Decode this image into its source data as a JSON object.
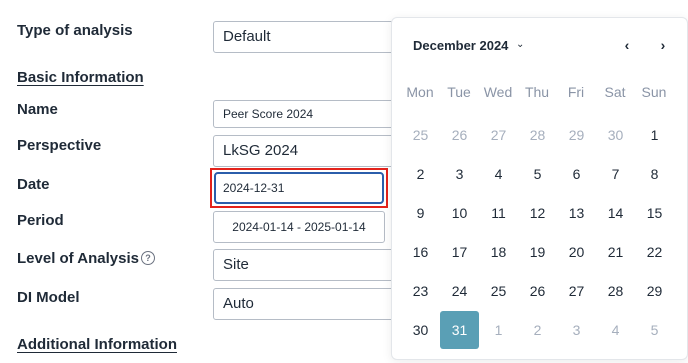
{
  "form": {
    "type_of_analysis_label": "Type of analysis",
    "type_of_analysis_value": "Default",
    "basic_information_heading": "Basic Information",
    "name_label": "Name",
    "name_value": "Peer Score 2024",
    "perspective_label": "Perspective",
    "perspective_value": "LkSG 2024",
    "date_label": "Date",
    "date_value": "2024-12-31",
    "period_label": "Period",
    "period_value": "2024-01-14 - 2025-01-14",
    "level_label": "Level of Analysis",
    "level_value": "Site",
    "help_icon": "help-circle-icon",
    "di_model_label": "DI Model",
    "di_model_value": "Auto",
    "additional_information_heading": "Additional Information"
  },
  "calendar": {
    "month_label": "December 2024",
    "month_dropdown_icon": "chevron-down-icon",
    "prev_icon": "chevron-left-icon",
    "next_icon": "chevron-right-icon",
    "weekdays": [
      "Mon",
      "Tue",
      "Wed",
      "Thu",
      "Fri",
      "Sat",
      "Sun"
    ],
    "weeks": [
      [
        {
          "d": "25",
          "m": true
        },
        {
          "d": "26",
          "m": true
        },
        {
          "d": "27",
          "m": true
        },
        {
          "d": "28",
          "m": true
        },
        {
          "d": "29",
          "m": true
        },
        {
          "d": "30",
          "m": true
        },
        {
          "d": "1",
          "m": false
        }
      ],
      [
        {
          "d": "2",
          "m": false
        },
        {
          "d": "3",
          "m": false
        },
        {
          "d": "4",
          "m": false
        },
        {
          "d": "5",
          "m": false
        },
        {
          "d": "6",
          "m": false
        },
        {
          "d": "7",
          "m": false
        },
        {
          "d": "8",
          "m": false
        }
      ],
      [
        {
          "d": "9",
          "m": false
        },
        {
          "d": "10",
          "m": false
        },
        {
          "d": "11",
          "m": false
        },
        {
          "d": "12",
          "m": false
        },
        {
          "d": "13",
          "m": false
        },
        {
          "d": "14",
          "m": false
        },
        {
          "d": "15",
          "m": false
        }
      ],
      [
        {
          "d": "16",
          "m": false
        },
        {
          "d": "17",
          "m": false
        },
        {
          "d": "18",
          "m": false
        },
        {
          "d": "19",
          "m": false
        },
        {
          "d": "20",
          "m": false
        },
        {
          "d": "21",
          "m": false
        },
        {
          "d": "22",
          "m": false
        }
      ],
      [
        {
          "d": "23",
          "m": false
        },
        {
          "d": "24",
          "m": false
        },
        {
          "d": "25",
          "m": false
        },
        {
          "d": "26",
          "m": false
        },
        {
          "d": "27",
          "m": false
        },
        {
          "d": "28",
          "m": false
        },
        {
          "d": "29",
          "m": false
        }
      ],
      [
        {
          "d": "30",
          "m": false
        },
        {
          "d": "31",
          "m": false,
          "selected": true
        },
        {
          "d": "1",
          "m": true
        },
        {
          "d": "2",
          "m": true
        },
        {
          "d": "3",
          "m": true
        },
        {
          "d": "4",
          "m": true
        },
        {
          "d": "5",
          "m": true
        }
      ]
    ],
    "selected_color": "#5a9fb5"
  },
  "highlight_color": "#e3221b"
}
